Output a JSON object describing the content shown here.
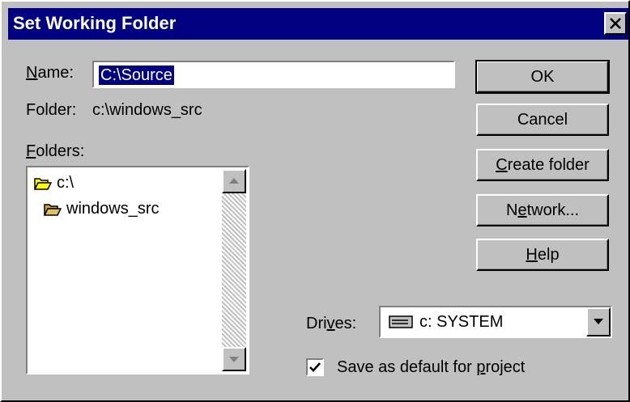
{
  "dialog": {
    "title": "Set Working Folder"
  },
  "name": {
    "label_u": "N",
    "label_rest": "ame:",
    "value": "C:\\Source"
  },
  "folder": {
    "label": "Folder:",
    "path": "c:\\windows_src"
  },
  "folders": {
    "label_u": "F",
    "label_rest": "olders:",
    "items": [
      {
        "label": "c:\\",
        "icon": "open-folder-icon"
      },
      {
        "label": "windows_src",
        "icon": "open-folder-icon"
      }
    ]
  },
  "buttons": {
    "ok": "OK",
    "cancel": "Cancel",
    "create_u": "C",
    "create_rest": "reate folder",
    "network_pre": "N",
    "network_u": "e",
    "network_rest": "twork...",
    "help_u": "H",
    "help_rest": "elp"
  },
  "drives": {
    "label_pre": "Dri",
    "label_u": "v",
    "label_rest": "es:",
    "value": "c: SYSTEM",
    "icon": "drive-icon"
  },
  "checkbox": {
    "label_pre": "Save as default for ",
    "label_u": "p",
    "label_rest": "roject",
    "checked": true
  },
  "colors": {
    "titlebar": "#000080",
    "face": "#c0c0c0",
    "selection": "#000080"
  }
}
